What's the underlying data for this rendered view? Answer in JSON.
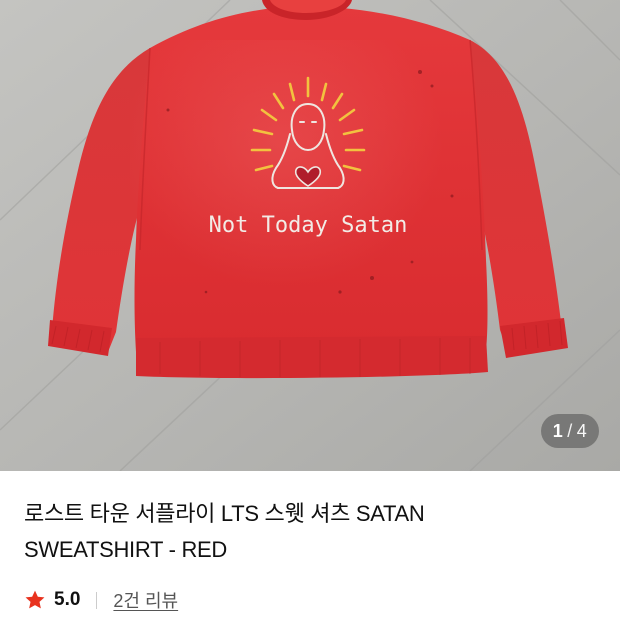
{
  "gallery": {
    "image_alt": "Red sweatshirt with a hand-drawn figure and the words Not Today Satan",
    "print_text": "Not Today Satan",
    "current": "1",
    "separator": "/",
    "total": "4"
  },
  "product": {
    "title_line1": "로스트 타운 서플라이 LTS 스웻 셔츠 SATAN",
    "title_line2": "SWEATSHIRT - RED"
  },
  "rating": {
    "icon": "star-icon",
    "value": "5.0",
    "reviews_label": "2건 리뷰",
    "star_color": "#e8321e"
  }
}
